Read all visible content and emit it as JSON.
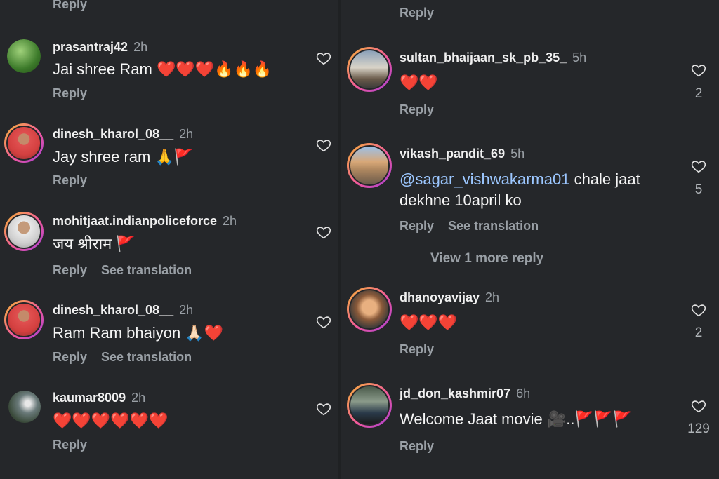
{
  "left": {
    "top_reply": "Reply",
    "comments": [
      {
        "user": "prasantraj42",
        "time": "2h",
        "text": "Jai shree Ram ❤️❤️❤️🔥🔥🔥",
        "actions": [
          "Reply"
        ]
      },
      {
        "user": "dinesh_kharol_08__",
        "time": "2h",
        "text": "Jay shree ram 🙏🚩",
        "actions": [
          "Reply"
        ]
      },
      {
        "user": "mohitjaat.indianpoliceforce",
        "time": "2h",
        "text": "जय श्रीराम 🚩",
        "actions": [
          "Reply",
          "See translation"
        ]
      },
      {
        "user": "dinesh_kharol_08__",
        "time": "2h",
        "text": "Ram Ram bhaiyon 🙏🏻❤️",
        "actions": [
          "Reply",
          "See translation"
        ]
      },
      {
        "user": "kaumar8009",
        "time": "2h",
        "text": "❤️❤️❤️❤️❤️❤️",
        "actions": [
          "Reply"
        ]
      }
    ]
  },
  "right": {
    "top_reply": "Reply",
    "comments": [
      {
        "user": "sultan_bhaijaan_sk_pb_35_",
        "time": "5h",
        "text": "❤️❤️",
        "actions": [
          "Reply"
        ],
        "likes": "2"
      },
      {
        "user": "vikash_pandit_69",
        "time": "5h",
        "mention": "@sagar_vishwakarma01",
        "text": " chale jaat",
        "text2": "dekhne 10april ko",
        "actions": [
          "Reply",
          "See translation"
        ],
        "likes": "5",
        "view_more": "View 1 more reply"
      },
      {
        "user": "dhanoyavijay",
        "time": "2h",
        "text": "❤️❤️❤️",
        "actions": [
          "Reply"
        ],
        "likes": "2"
      },
      {
        "user": "jd_don_kashmir07",
        "time": "6h",
        "text": "Welcome Jaat movie 🎥..🚩🚩🚩",
        "actions": [
          "Reply"
        ],
        "likes": "129"
      }
    ]
  },
  "colors": {
    "background": "#25272a",
    "muted": "#9aa0a6",
    "mention": "#9cc7ff",
    "heart": "#e63946"
  }
}
